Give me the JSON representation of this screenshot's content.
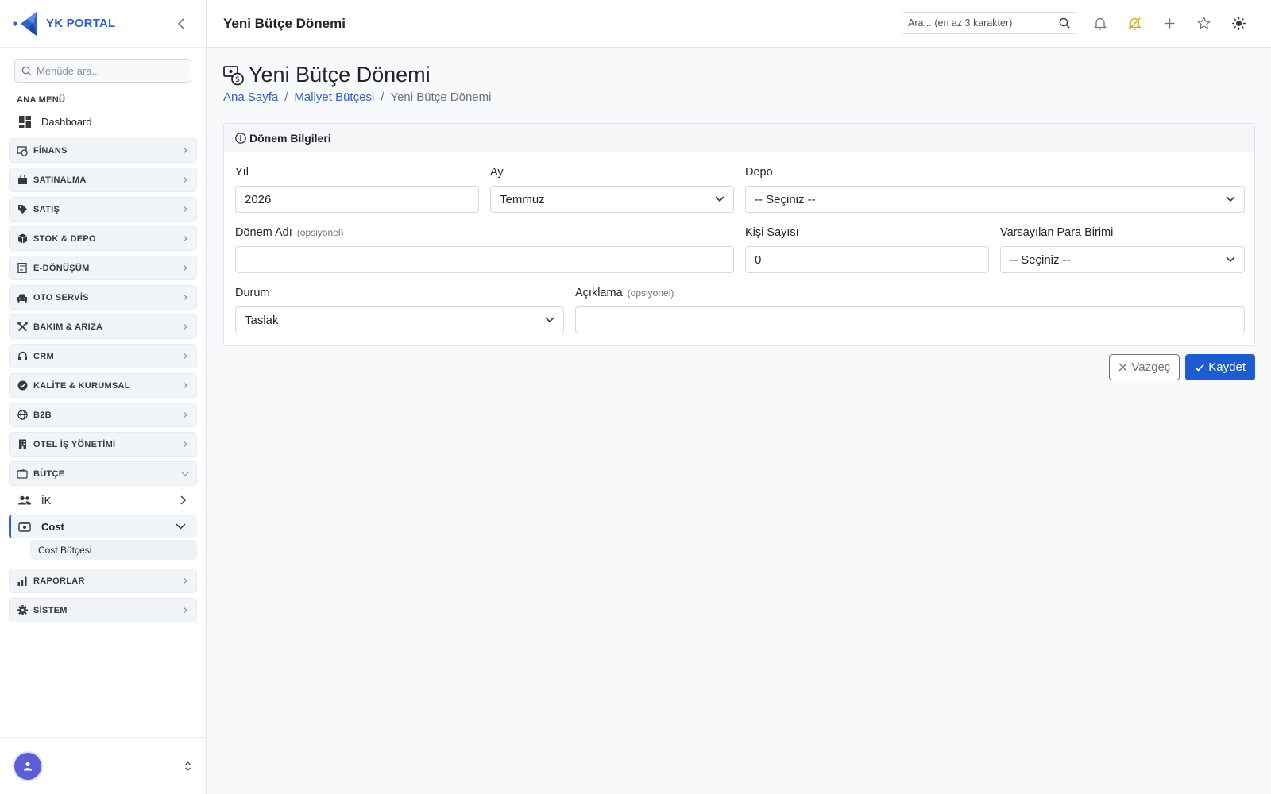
{
  "brand": {
    "name": "YK PORTAL"
  },
  "sidebar": {
    "search_placeholder": "Menüde ara...",
    "section_title": "ANA MENÜ",
    "dashboard": {
      "label": "Dashboard",
      "icon": "dashboard-icon"
    },
    "groups": [
      {
        "label": "FİNANS",
        "icon": "finance-icon"
      },
      {
        "label": "SATINALMA",
        "icon": "shopping-bag-icon"
      },
      {
        "label": "SATIŞ",
        "icon": "tag-icon"
      },
      {
        "label": "STOK & DEPO",
        "icon": "box-icon"
      },
      {
        "label": "E-DÖNÜŞÜM",
        "icon": "document-icon"
      },
      {
        "label": "OTO SERVİS",
        "icon": "car-icon"
      },
      {
        "label": "BAKIM & ARIZA",
        "icon": "tools-icon"
      },
      {
        "label": "CRM",
        "icon": "headset-icon"
      },
      {
        "label": "KALİTE & KURUMSAL",
        "icon": "badge-icon"
      },
      {
        "label": "B2B",
        "icon": "globe-icon"
      },
      {
        "label": "OTEL İŞ YÖNETİMİ",
        "icon": "building-icon"
      },
      {
        "label": "BÜTÇE",
        "icon": "wallet-icon"
      }
    ],
    "budget_children": [
      {
        "label": "İK",
        "icon": "people-icon"
      },
      {
        "label": "Cost",
        "icon": "cash-icon"
      }
    ],
    "cost_children": [
      {
        "label": "Cost Bütçesi"
      }
    ],
    "bottom_groups": [
      {
        "label": "RAPORLAR",
        "icon": "bar-chart-icon"
      },
      {
        "label": "SİSTEM",
        "icon": "gear-icon"
      }
    ]
  },
  "topbar": {
    "title": "Yeni Bütçe Dönemi",
    "search_placeholder": "Ara... (en az 3 karakter)"
  },
  "page": {
    "title": "Yeni Bütçe Dönemi",
    "breadcrumb": [
      "Ana Sayfa",
      "Maliyet Bütçesi",
      "Yeni Bütçe Dönemi"
    ]
  },
  "form": {
    "section_title": "Dönem Bilgileri",
    "year": {
      "label": "Yıl",
      "value": "2026"
    },
    "month": {
      "label": "Ay",
      "value": "Temmuz"
    },
    "warehouse": {
      "label": "Depo",
      "value": "-- Seçiniz --"
    },
    "period_name": {
      "label": "Dönem Adı",
      "optional": "(opsiyonel)",
      "value": ""
    },
    "headcount": {
      "label": "Kişi Sayısı",
      "value": "0"
    },
    "currency": {
      "label": "Varsayılan Para Birimi",
      "value": "-- Seçiniz --"
    },
    "status": {
      "label": "Durum",
      "value": "Taslak"
    },
    "description": {
      "label": "Açıklama",
      "optional": "(opsiyonel)",
      "value": ""
    },
    "cancel_label": "Vazgeç",
    "save_label": "Kaydet"
  },
  "colors": {
    "accent": "#2f62c9",
    "save_button": "#1f5bd0",
    "warning_bell": "#e0a800"
  }
}
